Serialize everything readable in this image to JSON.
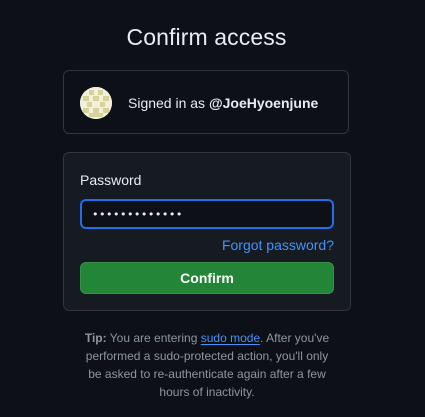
{
  "page": {
    "title": "Confirm access"
  },
  "account": {
    "avatar_icon": "identicon-avatar",
    "signed_in_prefix": "Signed in as",
    "username": "@JoeHyoenjune"
  },
  "form": {
    "password_label": "Password",
    "password_value": "•••••••••••••",
    "forgot_link": "Forgot password?",
    "confirm_label": "Confirm"
  },
  "tip": {
    "label": "Tip:",
    "text_before": "You are entering",
    "link": "sudo mode",
    "text_after": ". After you've performed a sudo-protected action, you'll only be asked to re-authenticate again after a few hours of inactivity."
  },
  "colors": {
    "background": "#0d1117",
    "accent": "#4493f8",
    "button": "#238636",
    "focus_ring": "#1f6feb"
  }
}
